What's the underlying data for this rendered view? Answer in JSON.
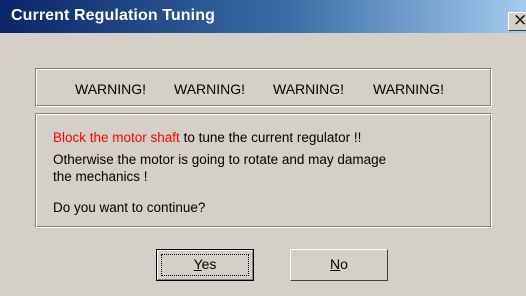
{
  "window": {
    "title": "Current Regulation Tuning",
    "close_glyph": "×"
  },
  "warnings": [
    "WARNING!",
    "WARNING!",
    "WARNING!",
    "WARNING!"
  ],
  "message": {
    "line1_red": "Block the motor shaft",
    "line1_rest": " to tune the current regulator !!",
    "line2": "Otherwise the motor is going to rotate and may damage",
    "line3": "the mechanics !",
    "question": "Do you want to continue?"
  },
  "buttons": {
    "yes_mnemonic": "Y",
    "yes_rest": "es",
    "no_mnemonic": "N",
    "no_rest": "o"
  },
  "colors": {
    "title_gradient_start": "#0a246a",
    "title_gradient_end": "#a6caf0",
    "warning_text": "#ff0000",
    "face": "#d4d0c8"
  },
  "icons": {
    "close": "close-icon"
  }
}
